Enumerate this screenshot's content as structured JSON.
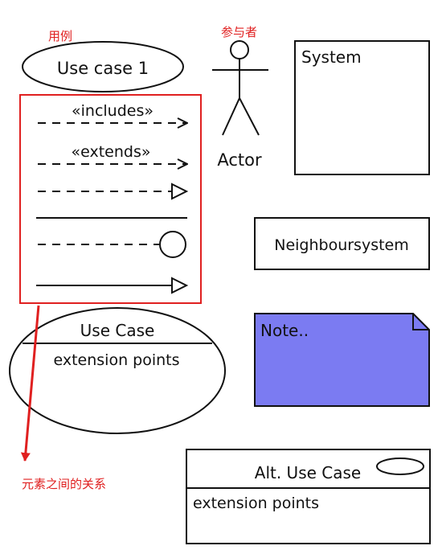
{
  "annotations": {
    "use_case_label": "用例",
    "actor_label": "参与者",
    "relations_label": "元素之间的关系",
    "color": "#e02020"
  },
  "palette": {
    "use_case_1": "Use case 1",
    "actor": "Actor",
    "system": "System",
    "neighbour_system": "Neighboursystem",
    "note": "Note..",
    "note_fill": "#7b7bf2",
    "relations": {
      "includes": "«includes»",
      "extends": "«extends»"
    },
    "use_case_ellipse": {
      "name": "Use Case",
      "compartment": "extension points"
    },
    "alt_use_case": {
      "name": "Alt. Use Case",
      "compartment": "extension points"
    }
  }
}
